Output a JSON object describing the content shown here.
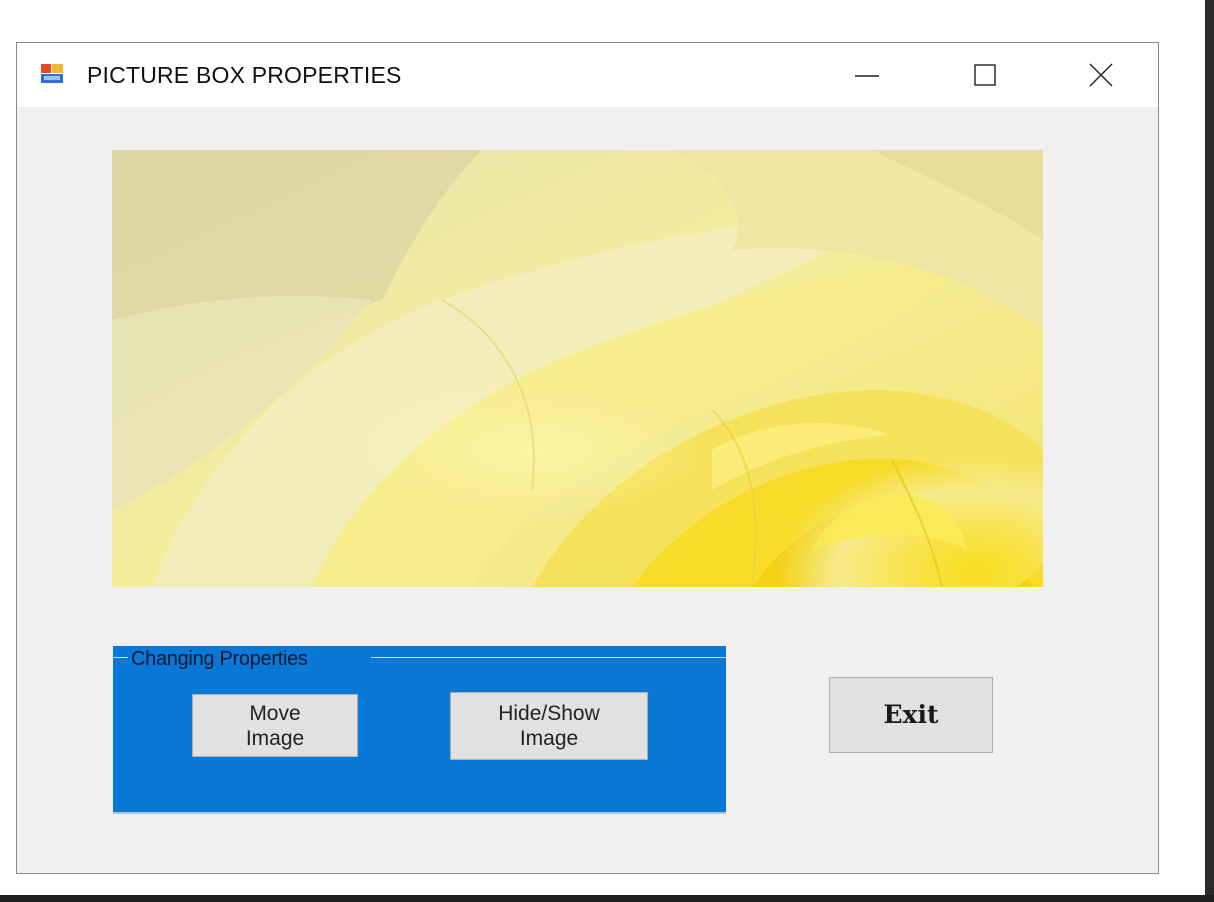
{
  "window": {
    "title": "PICTURE BOX PROPERTIES",
    "icon": "app-form-icon",
    "controls": [
      "minimize-icon",
      "maximize-icon",
      "close-icon"
    ]
  },
  "picture_box": {
    "content": "yellow rose photo"
  },
  "group": {
    "label": "Changing Properties",
    "background_color": "#0a78d7"
  },
  "buttons": {
    "move_line1": "Move",
    "move_line2": "Image",
    "hide_line1": "Hide/Show",
    "hide_line2": "Image",
    "exit": "Exit"
  }
}
